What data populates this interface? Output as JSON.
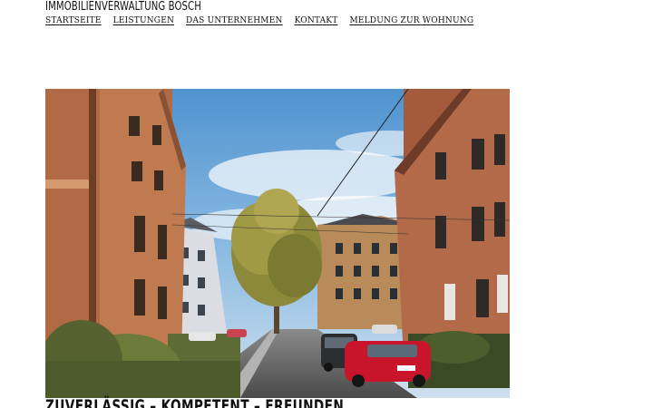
{
  "site": {
    "title": "IMMOBILIENVERWALTUNG BOSCH"
  },
  "nav": {
    "items": [
      {
        "label": "STARTSEITE"
      },
      {
        "label": "LEISTUNGEN"
      },
      {
        "label": "DAS UNTERNEHMEN"
      },
      {
        "label": "KONTAKT"
      },
      {
        "label": "MELDUNG ZUR WOHNUNG"
      }
    ]
  },
  "hero": {
    "tagline": "ZUVERLÄSSIG – KOMPETENT – FREUNDEN"
  }
}
